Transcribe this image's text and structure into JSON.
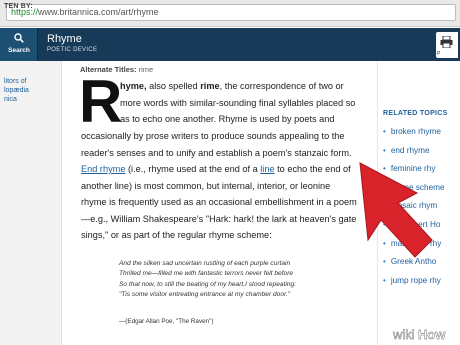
{
  "browser": {
    "url_scheme": "https://",
    "url_rest": "www.britannica.com/art/rhyme"
  },
  "header": {
    "search_label": "Search",
    "title": "Rhyme",
    "subtitle": "POETIC DEVICE",
    "print_label": "P"
  },
  "left": {
    "written_by": "TEN BY:",
    "links": [
      "litors of",
      "lopædia",
      "nica"
    ]
  },
  "main": {
    "alt_label": "Alternate Titles:",
    "alt_value": "rime",
    "drop_cap": "R",
    "para1": [
      {
        "parts": [
          {
            "t": "hyme,",
            "c": "bold"
          },
          {
            "t": " also spelled "
          },
          {
            "t": "rime",
            "c": "bold"
          },
          {
            "t": ", the correspondence of two or"
          }
        ]
      },
      {
        "parts": [
          {
            "t": "more words with similar-sounding final syllables placed so"
          }
        ]
      },
      {
        "parts": [
          {
            "t": "as to echo one another. Rhyme is used by poets and"
          }
        ]
      },
      {
        "parts": [
          {
            "t": "occasionally by prose writers to produce sounds appealing to the"
          }
        ]
      },
      {
        "parts": [
          {
            "t": "reader's senses and to unify and establish a poem's stanzaic form."
          }
        ]
      },
      {
        "parts": [
          {
            "t": "End rhyme",
            "c": "link"
          },
          {
            "t": " (i.e., rhyme used at the end of a "
          },
          {
            "t": "line",
            "c": "link"
          },
          {
            "t": " to echo the end of"
          }
        ]
      },
      {
        "parts": [
          {
            "t": "another line) is most common, but internal, interior, or leonine"
          }
        ]
      },
      {
        "parts": [
          {
            "t": "rhyme is frequently used as an occasional embellishment in a poem"
          }
        ]
      },
      {
        "parts": [
          {
            "t": "—e.g., William Shakespeare's \"Hark: hark! the lark at heaven's gate"
          }
        ]
      },
      {
        "parts": [
          {
            "t": "sings,\" or as part of the regular rhyme scheme:"
          }
        ]
      }
    ],
    "quote": [
      "And the silken sad uncertain rustling of each purple curtain",
      "Thrilled me—filled me with fantastic terrors never felt before",
      "So that now, to still the beating of my heart,I stood repeating:",
      "\"Tis some visitor entreating entrance at my chamber door.\""
    ],
    "quote_cite": "—(Edgar Allan Poe, \"The Raven\")"
  },
  "related": {
    "title": "RELATED TOPICS",
    "items": [
      "broken rhyme",
      "end rhyme",
      "feminine rhy",
      "rhyme scheme",
      "mosaic rhym",
      "Sir Robert Ho",
      "masculine rhy",
      "Greek Antho",
      "jump rope rhy"
    ]
  },
  "watermark": {
    "wiki": "wiki",
    "how": "How"
  },
  "colors": {
    "header_bg": "#163a57",
    "link": "#1f5f9c",
    "arrow": "#d9232a"
  }
}
